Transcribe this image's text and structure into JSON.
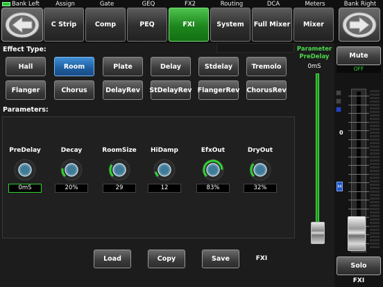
{
  "nav": {
    "bank_left_label": "Bank Left",
    "bank_right_label": "Bank Right",
    "tabs": [
      {
        "label": "Assign",
        "button": "C Strip"
      },
      {
        "label": "Gate",
        "button": "Comp"
      },
      {
        "label": "GEQ",
        "button": "PEQ"
      },
      {
        "label": "FX2",
        "button": "FXI"
      },
      {
        "label": "Routing",
        "button": "System"
      },
      {
        "label": "DCA",
        "button": "Full Mixer"
      },
      {
        "label": "Meters",
        "button": "Mixer"
      }
    ],
    "active_index": 3,
    "bank_indicator_color": "#27c23a",
    "bank_left_icon": "arrow-left-icon",
    "bank_right_icon": "arrow-right-icon"
  },
  "effect_type": {
    "label": "Effect Type:",
    "types": [
      "Hall",
      "Room",
      "Plate",
      "Delay",
      "Stdelay",
      "Tremolo",
      "Flanger",
      "Chorus",
      "DelayRev",
      "StDelayRev",
      "FlangerRev",
      "ChorusRev"
    ],
    "selected": "Room"
  },
  "parameters": {
    "label": "Parameters:",
    "items": [
      {
        "name": "PreDelay",
        "value": "0mS",
        "fraction": 0.0,
        "active": true
      },
      {
        "name": "Decay",
        "value": "20%",
        "fraction": 0.2,
        "active": false
      },
      {
        "name": "RoomSize",
        "value": "29",
        "fraction": 0.29,
        "active": false
      },
      {
        "name": "HiDamp",
        "value": "12",
        "fraction": 0.12,
        "active": false
      },
      {
        "name": "EfxOut",
        "value": "83%",
        "fraction": 0.83,
        "active": false
      },
      {
        "name": "DryOut",
        "value": "32%",
        "fraction": 0.32,
        "active": false
      }
    ]
  },
  "actions": {
    "load": "Load",
    "copy": "Copy",
    "save": "Save",
    "fx_name": "FXI"
  },
  "param_slider": {
    "title_line1": "Parameter",
    "title_line2": "PreDelay",
    "value": "0mS",
    "fraction": 0.0
  },
  "channel": {
    "mute": "Mute",
    "mute_status": "OFF",
    "zero_label": "0",
    "m_badge": "M",
    "solo": "Solo",
    "name": "FXI"
  },
  "colors": {
    "accent_green": "#2fd22f",
    "selected_blue": "#2a72b8"
  }
}
